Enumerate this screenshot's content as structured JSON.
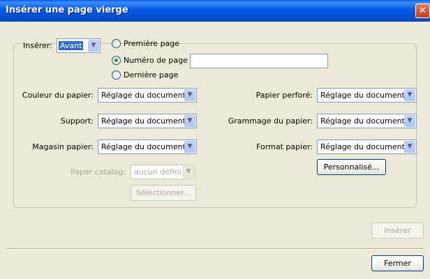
{
  "window": {
    "title": "Insérer une page vierge",
    "close_glyph": "✕"
  },
  "insert": {
    "label": "Insérer:",
    "position_value": "Avant",
    "radios": {
      "first_page": "Première page",
      "page_number": "Numéro de page",
      "last_page": "Dernière page"
    },
    "page_number_value": ""
  },
  "left_fields": {
    "paper_color": {
      "label": "Couleur du papier:",
      "value": "Réglage du document"
    },
    "media": {
      "label": "Support:",
      "value": "Réglage du document"
    },
    "paper_tray": {
      "label": "Magasin papier:",
      "value": "Réglage du document"
    }
  },
  "right_fields": {
    "punched_paper": {
      "label": "Papier perforé:",
      "value": "Réglage du document"
    },
    "paper_weight": {
      "label": "Grammage du papier:",
      "value": "Réglage du document"
    },
    "paper_format": {
      "label": "Format papier:",
      "value": "Réglage du document"
    }
  },
  "paper_catalog": {
    "label": "Paper catalog:",
    "value": "aucun défini"
  },
  "buttons": {
    "select": "Sélectionner...",
    "custom": "Personnalisé...",
    "insert": "Insérer",
    "close": "Fermer"
  },
  "icons": {
    "dropdown_arrow": "▼"
  },
  "colors": {
    "title_bar": "#0552d7",
    "dialog_bg": "#ece9d8",
    "radio_dot": "#21a121"
  }
}
